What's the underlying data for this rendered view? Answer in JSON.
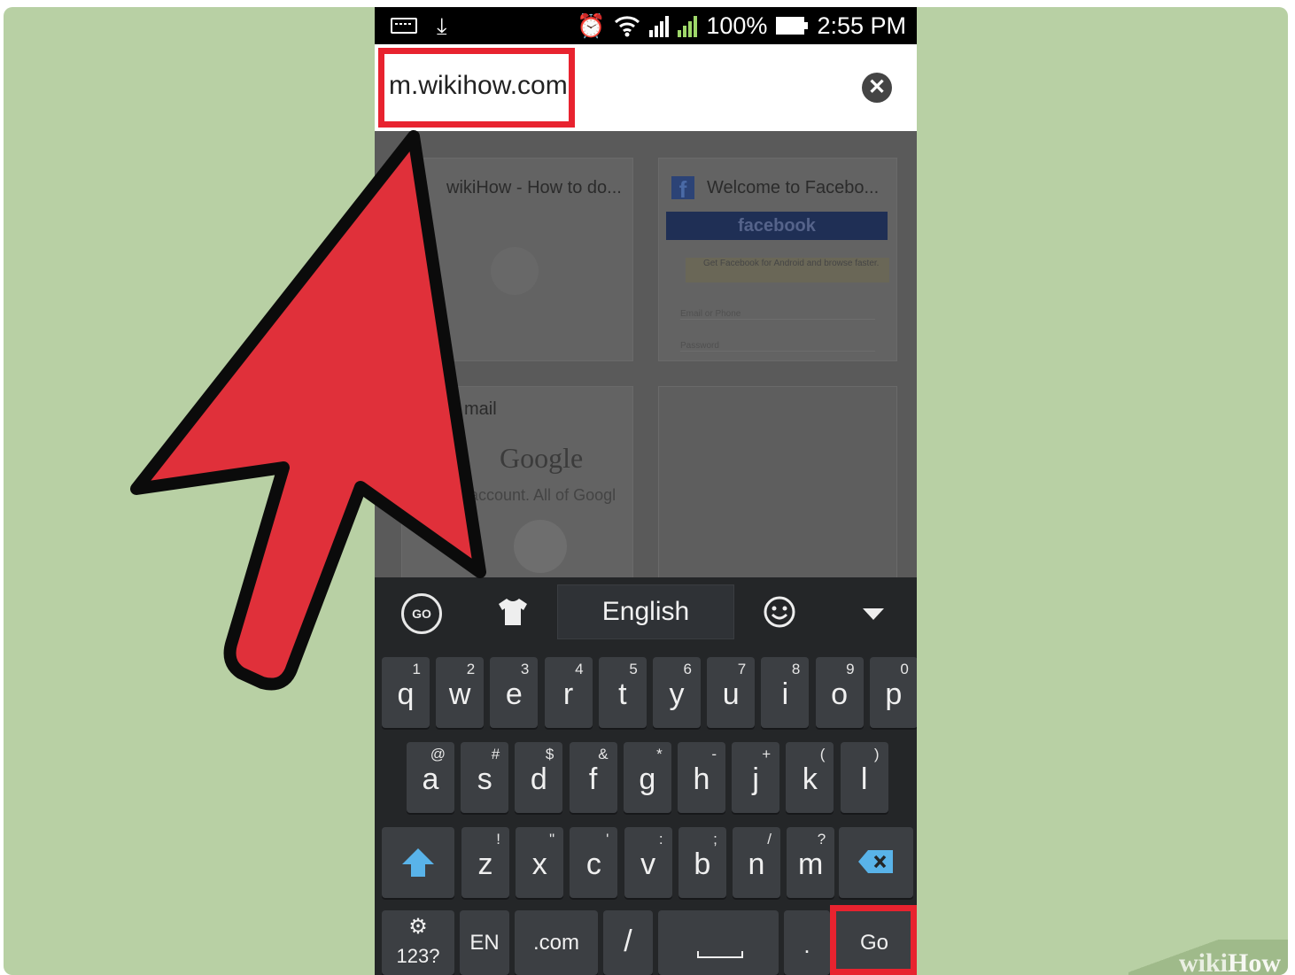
{
  "status_bar": {
    "battery": "100%",
    "time": "2:55 PM",
    "icons": [
      "keyboard-icon",
      "download-icon",
      "alarm-icon",
      "wifi-icon",
      "signal-sim1-icon",
      "signal-sim2-icon",
      "battery-icon"
    ]
  },
  "url_bar": {
    "value": "m.wikihow.com",
    "clear_icon": "close-icon"
  },
  "tiles": {
    "wikihow_title": "wikiHow - How to do...",
    "facebook_title": "Welcome to Facebo...",
    "facebook_banner": "facebook",
    "facebook_promo": "Get Facebook for Android and browse faster.",
    "facebook_email_placeholder": "Email or Phone",
    "facebook_password_placeholder": "Password",
    "gmail_title": "mail",
    "google_logo": "Google",
    "google_subtitle": "account. All of Googl"
  },
  "keyboard": {
    "toolbar": {
      "language": "English",
      "icons": [
        "go-logo-icon",
        "theme-shirt-icon",
        "emoji-icon",
        "collapse-icon"
      ]
    },
    "row1": [
      {
        "key": "q",
        "hint": "1"
      },
      {
        "key": "w",
        "hint": "2"
      },
      {
        "key": "e",
        "hint": "3"
      },
      {
        "key": "r",
        "hint": "4"
      },
      {
        "key": "t",
        "hint": "5"
      },
      {
        "key": "y",
        "hint": "6"
      },
      {
        "key": "u",
        "hint": "7"
      },
      {
        "key": "i",
        "hint": "8"
      },
      {
        "key": "o",
        "hint": "9"
      },
      {
        "key": "p",
        "hint": "0"
      }
    ],
    "row2": [
      {
        "key": "a",
        "hint": "@"
      },
      {
        "key": "s",
        "hint": "#"
      },
      {
        "key": "d",
        "hint": "$"
      },
      {
        "key": "f",
        "hint": "&"
      },
      {
        "key": "g",
        "hint": "*"
      },
      {
        "key": "h",
        "hint": "-"
      },
      {
        "key": "j",
        "hint": "+"
      },
      {
        "key": "k",
        "hint": "("
      },
      {
        "key": "l",
        "hint": ")"
      }
    ],
    "row3": [
      {
        "key": "z",
        "hint": "!"
      },
      {
        "key": "x",
        "hint": "\""
      },
      {
        "key": "c",
        "hint": "'"
      },
      {
        "key": "v",
        "hint": ":"
      },
      {
        "key": "b",
        "hint": ";"
      },
      {
        "key": "n",
        "hint": "/"
      },
      {
        "key": "m",
        "hint": "?"
      }
    ],
    "bottom": {
      "symbols": "123?",
      "lang": "EN",
      "dotcom": ".com",
      "slash": "/",
      "period": ".",
      "go": "Go"
    }
  },
  "watermark": {
    "wiki": "wiki",
    "how": "How"
  },
  "colors": {
    "highlight": "#e8232f",
    "background": "#b8d0a4",
    "keyboard": "#242628"
  }
}
